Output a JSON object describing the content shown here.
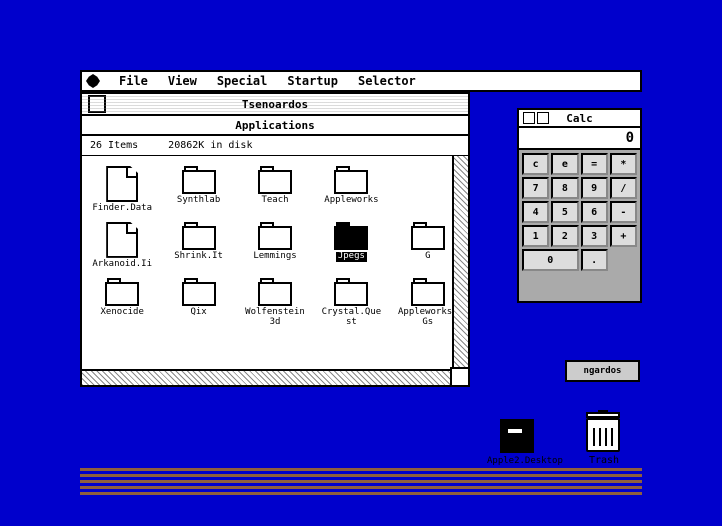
{
  "desktop": {
    "background": "#0000CC"
  },
  "menu_bar": {
    "apple_label": "",
    "items": [
      "File",
      "View",
      "Special",
      "Startup",
      "Selector"
    ]
  },
  "finder_window": {
    "title": "Tsenoardos",
    "subtitle": "Applications",
    "info": {
      "items_count": "26 Items",
      "disk_space": "20862K in disk"
    },
    "files": [
      {
        "name": "Finder.Data",
        "type": "document"
      },
      {
        "name": "Synthlab",
        "type": "folder"
      },
      {
        "name": "Teach",
        "type": "folder"
      },
      {
        "name": "Appleworks",
        "type": "folder"
      },
      {
        "name": "Arkanoid.Ii",
        "type": "document"
      },
      {
        "name": "Shrink.It",
        "type": "folder"
      },
      {
        "name": "Lemmings",
        "type": "folder"
      },
      {
        "name": "Jpegs",
        "type": "folder_black"
      },
      {
        "name": "Xenocide",
        "type": "folder"
      },
      {
        "name": "Qix",
        "type": "folder"
      },
      {
        "name": "Wolfenstein3d",
        "type": "folder"
      },
      {
        "name": "Crystal.Quest",
        "type": "folder"
      },
      {
        "name": "Appleworks.Gs",
        "type": "folder"
      }
    ]
  },
  "calc_window": {
    "title": "Calc",
    "display_value": "0",
    "buttons": [
      {
        "label": "c",
        "key": "clear"
      },
      {
        "label": "e",
        "key": "e"
      },
      {
        "label": "=",
        "key": "equals"
      },
      {
        "label": "*",
        "key": "multiply"
      },
      {
        "label": "7",
        "key": "7"
      },
      {
        "label": "8",
        "key": "8"
      },
      {
        "label": "9",
        "key": "9"
      },
      {
        "label": "/",
        "key": "divide"
      },
      {
        "label": "4",
        "key": "4"
      },
      {
        "label": "5",
        "key": "5"
      },
      {
        "label": "6",
        "key": "6"
      },
      {
        "label": "-",
        "key": "minus"
      },
      {
        "label": "1",
        "key": "1"
      },
      {
        "label": "2",
        "key": "2"
      },
      {
        "label": "3",
        "key": "3"
      },
      {
        "label": "+",
        "key": "plus"
      },
      {
        "label": "0",
        "key": "0",
        "wide": true
      },
      {
        "label": ".",
        "key": "decimal"
      }
    ]
  },
  "small_window": {
    "label": "ngardos"
  },
  "disk": {
    "label": "Apple2.Desktop"
  },
  "trash": {
    "label": "Trash"
  }
}
